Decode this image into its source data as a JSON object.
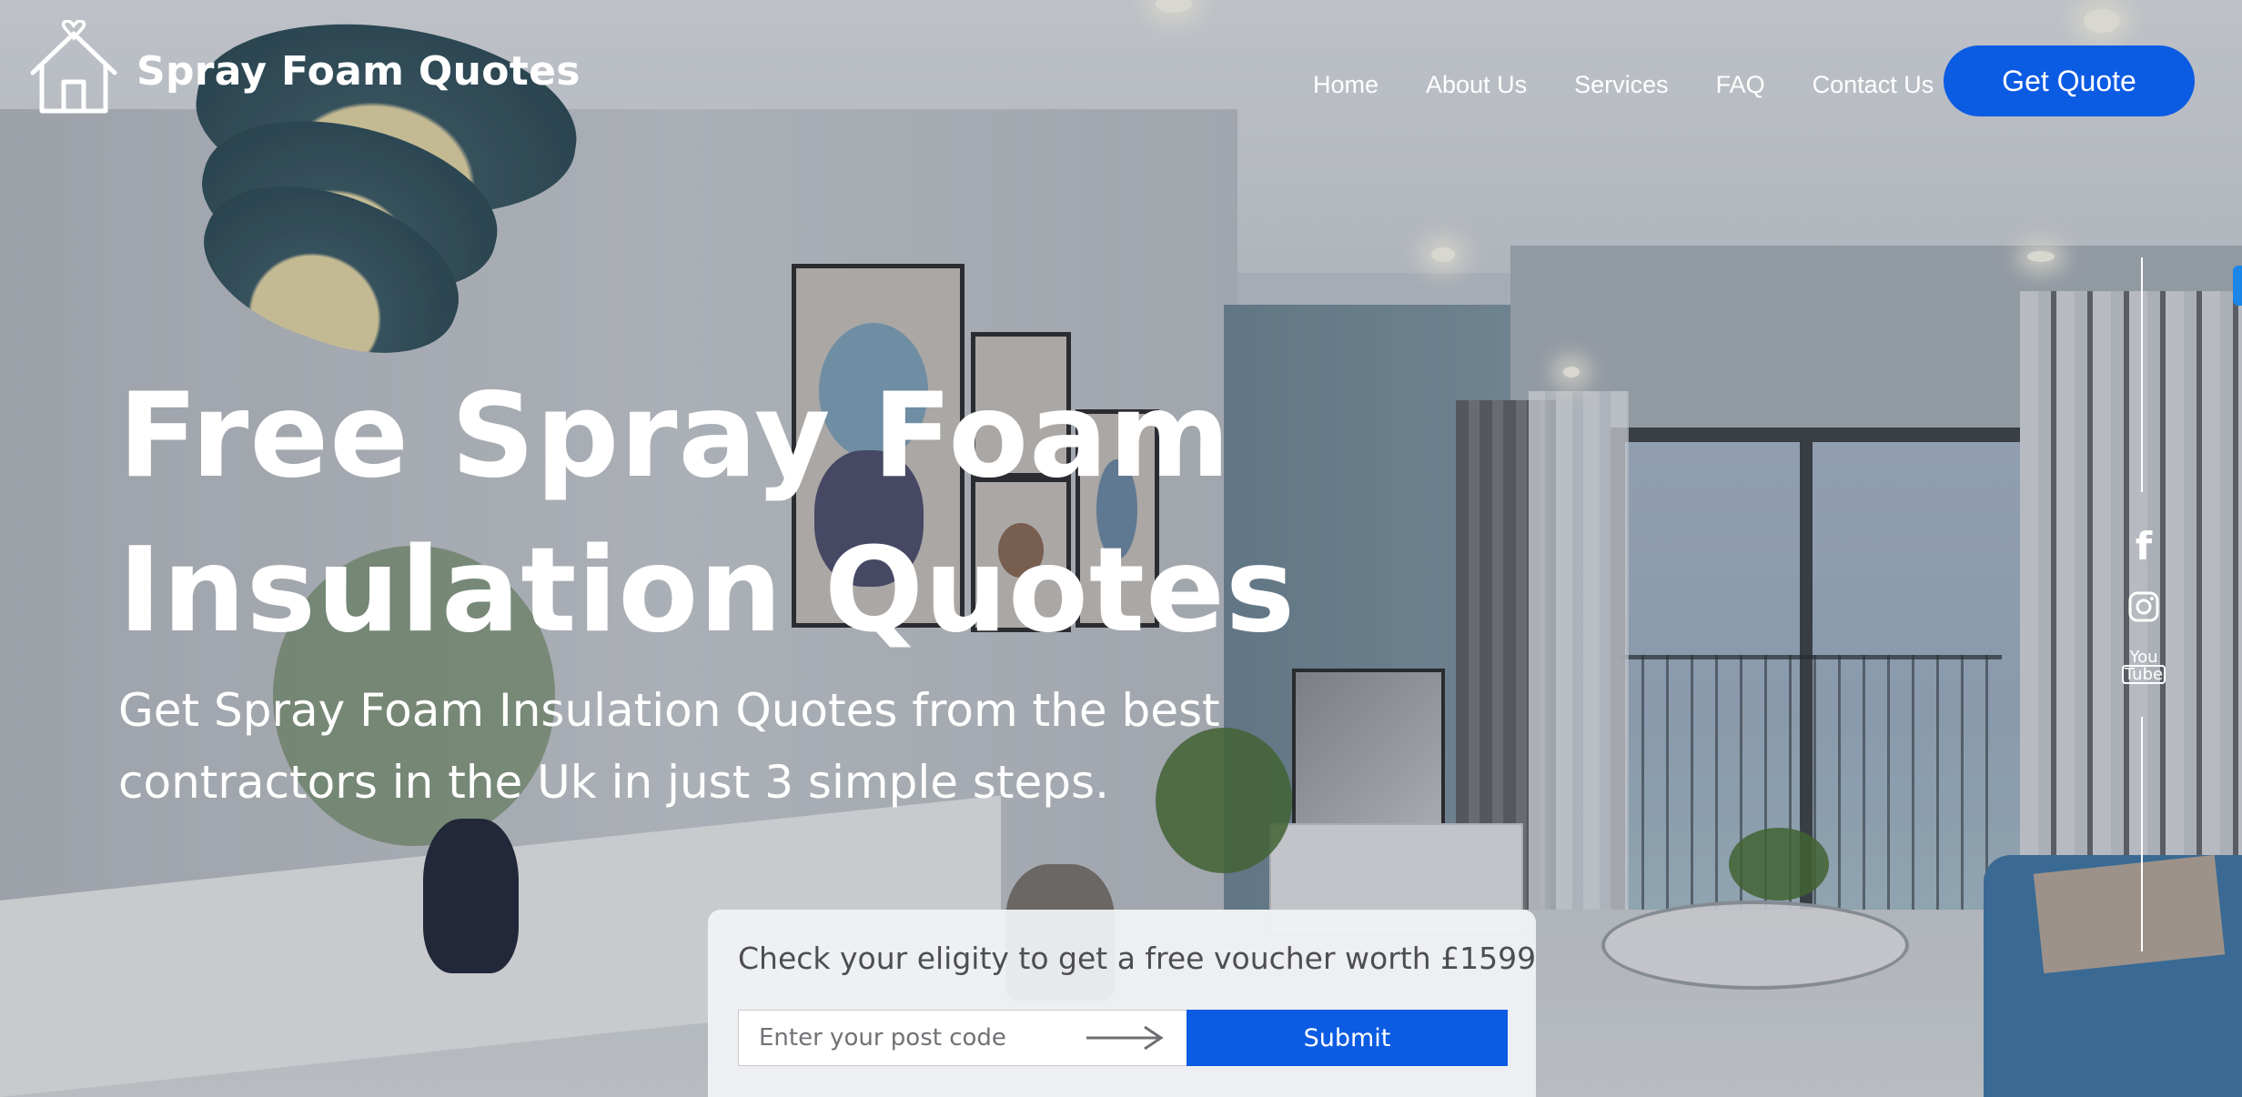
{
  "brand": {
    "name": "Spray Foam Quotes"
  },
  "nav": {
    "items": [
      {
        "label": "Home"
      },
      {
        "label": "About Us"
      },
      {
        "label": "Services"
      },
      {
        "label": "FAQ"
      },
      {
        "label": "Contact Us"
      }
    ],
    "cta_label": "Get Quote"
  },
  "hero": {
    "title_line1": "Free Spray Foam",
    "title_line2": "Insulation Quotes",
    "subtitle_line1": "Get Spray Foam Insulation Quotes from the best",
    "subtitle_line2": "contractors in the Uk in just 3 simple steps."
  },
  "form": {
    "title": "Check your eligity to get a free voucher worth £1599",
    "postcode_placeholder": "Enter your post code",
    "postcode_value": "",
    "submit_label": "Submit"
  },
  "social": {
    "icons": [
      "facebook-icon",
      "instagram-icon",
      "youtube-icon"
    ],
    "youtube_text_top": "You",
    "youtube_text_bottom": "Tube",
    "facebook_glyph": "f"
  },
  "colors": {
    "accent": "#0c5be3",
    "text_on_hero": "#ffffff",
    "card_bg": "#f2f3f5"
  }
}
